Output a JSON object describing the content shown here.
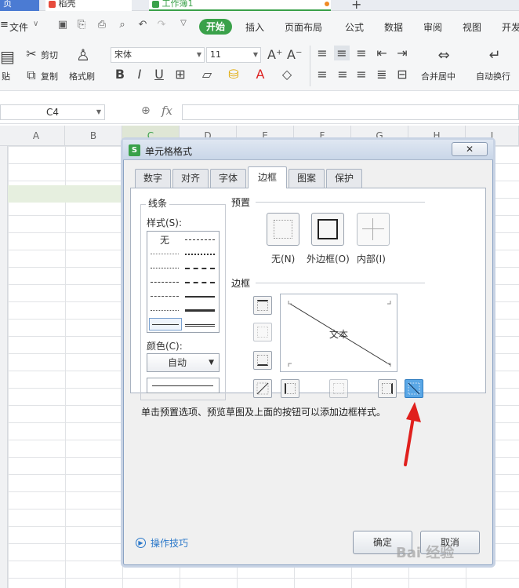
{
  "tabs": [
    "页",
    "稻壳",
    "工作簿1"
  ],
  "menu": [
    "文件",
    "开始",
    "插入",
    "页面布局",
    "公式",
    "数据",
    "审阅",
    "视图",
    "开发"
  ],
  "ribbon": {
    "paste": "贴",
    "cut": "剪切",
    "copy": "复制",
    "format_painter": "格式刷",
    "font_name": "宋体",
    "font_size": "11",
    "merge_center": "合并居中",
    "wrap_text": "自动换行"
  },
  "formula_bar": {
    "name_box": "C4",
    "fx": "fx"
  },
  "columns": [
    "A",
    "B",
    "C",
    "D",
    "E",
    "F",
    "G",
    "H",
    "I"
  ],
  "dialog": {
    "title": "单元格格式",
    "icon": "S",
    "tabs": [
      "数字",
      "对齐",
      "字体",
      "边框",
      "图案",
      "保护"
    ],
    "active_tab": "边框",
    "line_section": "线条",
    "style_label": "样式(S):",
    "style_none": "无",
    "color_label": "颜色(C):",
    "color_value": "自动",
    "preset_section": "预置",
    "presets": [
      "无(N)",
      "外边框(O)",
      "内部(I)"
    ],
    "border_section": "边框",
    "preview_text": "文本",
    "hint": "单击预置选项、预览草图及上面的按钮可以添加边框样式。",
    "tips_link": "操作技巧",
    "ok": "确定",
    "cancel": "取消"
  },
  "watermark": "Bai 经验",
  "colors": {
    "accent_green": "#3aa14a",
    "arrow_red": "#e0201d",
    "selected_button": "#5aa7e6"
  },
  "icons": [
    "close-icon",
    "arrow-icon",
    "diagonal-border-icon",
    "fx-icon",
    "zoom-icon"
  ]
}
